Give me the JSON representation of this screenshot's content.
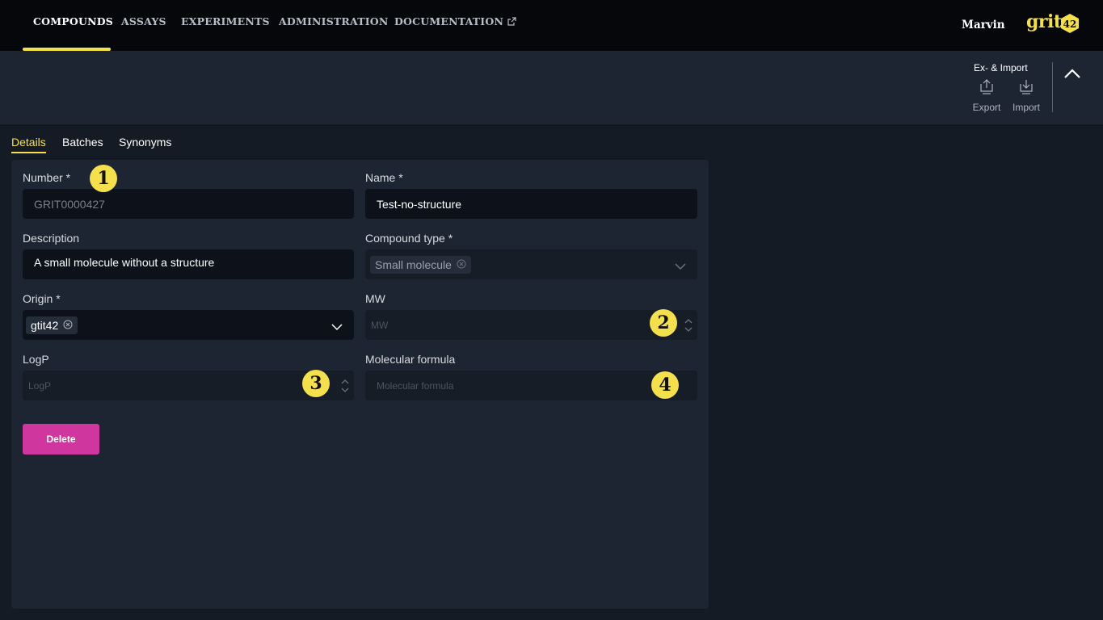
{
  "nav": {
    "items": [
      {
        "label": "COMPOUNDS",
        "active": true
      },
      {
        "label": "ASSAYS",
        "active": false
      },
      {
        "label": "EXPERIMENTS",
        "active": false
      },
      {
        "label": "ADMINISTRATION",
        "active": false
      },
      {
        "label": "DOCUMENTATION",
        "active": false,
        "external": true
      }
    ],
    "user": "Marvin",
    "logo_text": "grit",
    "logo_badge": "42"
  },
  "toolbar": {
    "group_title": "Ex- & Import",
    "export_label": "Export",
    "import_label": "Import"
  },
  "tabs": [
    {
      "label": "Details",
      "active": true
    },
    {
      "label": "Batches",
      "active": false
    },
    {
      "label": "Synonyms",
      "active": false
    }
  ],
  "form": {
    "number": {
      "label": "Number *",
      "value": "GRIT0000427"
    },
    "name": {
      "label": "Name *",
      "value": "Test-no-structure"
    },
    "description": {
      "label": "Description",
      "value": "A small molecule without a structure"
    },
    "compound_type": {
      "label": "Compound type *",
      "value": "Small molecule"
    },
    "origin": {
      "label": "Origin *",
      "value": "gtit42"
    },
    "mw": {
      "label": "MW",
      "placeholder": "MW"
    },
    "logp": {
      "label": "LogP",
      "placeholder": "LogP"
    },
    "molecular_formula": {
      "label": "Molecular formula",
      "placeholder": "Molecular formula"
    },
    "delete_label": "Delete"
  },
  "annotations": [
    "1",
    "2",
    "3",
    "4"
  ],
  "colors": {
    "accent": "#f4e04d",
    "danger": "#d0379e",
    "background": "#151b25",
    "panel": "#1e2532"
  }
}
